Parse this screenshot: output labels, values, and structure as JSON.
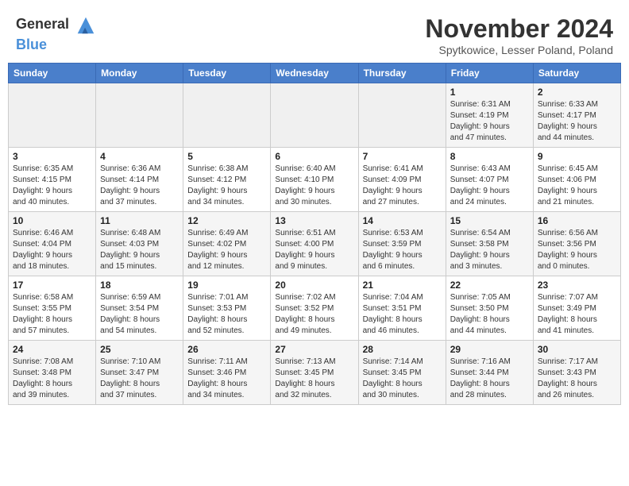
{
  "header": {
    "logo_general": "General",
    "logo_blue": "Blue",
    "month_title": "November 2024",
    "location": "Spytkowice, Lesser Poland, Poland"
  },
  "days_of_week": [
    "Sunday",
    "Monday",
    "Tuesday",
    "Wednesday",
    "Thursday",
    "Friday",
    "Saturday"
  ],
  "weeks": [
    [
      {
        "day": "",
        "info": ""
      },
      {
        "day": "",
        "info": ""
      },
      {
        "day": "",
        "info": ""
      },
      {
        "day": "",
        "info": ""
      },
      {
        "day": "",
        "info": ""
      },
      {
        "day": "1",
        "info": "Sunrise: 6:31 AM\nSunset: 4:19 PM\nDaylight: 9 hours\nand 47 minutes."
      },
      {
        "day": "2",
        "info": "Sunrise: 6:33 AM\nSunset: 4:17 PM\nDaylight: 9 hours\nand 44 minutes."
      }
    ],
    [
      {
        "day": "3",
        "info": "Sunrise: 6:35 AM\nSunset: 4:15 PM\nDaylight: 9 hours\nand 40 minutes."
      },
      {
        "day": "4",
        "info": "Sunrise: 6:36 AM\nSunset: 4:14 PM\nDaylight: 9 hours\nand 37 minutes."
      },
      {
        "day": "5",
        "info": "Sunrise: 6:38 AM\nSunset: 4:12 PM\nDaylight: 9 hours\nand 34 minutes."
      },
      {
        "day": "6",
        "info": "Sunrise: 6:40 AM\nSunset: 4:10 PM\nDaylight: 9 hours\nand 30 minutes."
      },
      {
        "day": "7",
        "info": "Sunrise: 6:41 AM\nSunset: 4:09 PM\nDaylight: 9 hours\nand 27 minutes."
      },
      {
        "day": "8",
        "info": "Sunrise: 6:43 AM\nSunset: 4:07 PM\nDaylight: 9 hours\nand 24 minutes."
      },
      {
        "day": "9",
        "info": "Sunrise: 6:45 AM\nSunset: 4:06 PM\nDaylight: 9 hours\nand 21 minutes."
      }
    ],
    [
      {
        "day": "10",
        "info": "Sunrise: 6:46 AM\nSunset: 4:04 PM\nDaylight: 9 hours\nand 18 minutes."
      },
      {
        "day": "11",
        "info": "Sunrise: 6:48 AM\nSunset: 4:03 PM\nDaylight: 9 hours\nand 15 minutes."
      },
      {
        "day": "12",
        "info": "Sunrise: 6:49 AM\nSunset: 4:02 PM\nDaylight: 9 hours\nand 12 minutes."
      },
      {
        "day": "13",
        "info": "Sunrise: 6:51 AM\nSunset: 4:00 PM\nDaylight: 9 hours\nand 9 minutes."
      },
      {
        "day": "14",
        "info": "Sunrise: 6:53 AM\nSunset: 3:59 PM\nDaylight: 9 hours\nand 6 minutes."
      },
      {
        "day": "15",
        "info": "Sunrise: 6:54 AM\nSunset: 3:58 PM\nDaylight: 9 hours\nand 3 minutes."
      },
      {
        "day": "16",
        "info": "Sunrise: 6:56 AM\nSunset: 3:56 PM\nDaylight: 9 hours\nand 0 minutes."
      }
    ],
    [
      {
        "day": "17",
        "info": "Sunrise: 6:58 AM\nSunset: 3:55 PM\nDaylight: 8 hours\nand 57 minutes."
      },
      {
        "day": "18",
        "info": "Sunrise: 6:59 AM\nSunset: 3:54 PM\nDaylight: 8 hours\nand 54 minutes."
      },
      {
        "day": "19",
        "info": "Sunrise: 7:01 AM\nSunset: 3:53 PM\nDaylight: 8 hours\nand 52 minutes."
      },
      {
        "day": "20",
        "info": "Sunrise: 7:02 AM\nSunset: 3:52 PM\nDaylight: 8 hours\nand 49 minutes."
      },
      {
        "day": "21",
        "info": "Sunrise: 7:04 AM\nSunset: 3:51 PM\nDaylight: 8 hours\nand 46 minutes."
      },
      {
        "day": "22",
        "info": "Sunrise: 7:05 AM\nSunset: 3:50 PM\nDaylight: 8 hours\nand 44 minutes."
      },
      {
        "day": "23",
        "info": "Sunrise: 7:07 AM\nSunset: 3:49 PM\nDaylight: 8 hours\nand 41 minutes."
      }
    ],
    [
      {
        "day": "24",
        "info": "Sunrise: 7:08 AM\nSunset: 3:48 PM\nDaylight: 8 hours\nand 39 minutes."
      },
      {
        "day": "25",
        "info": "Sunrise: 7:10 AM\nSunset: 3:47 PM\nDaylight: 8 hours\nand 37 minutes."
      },
      {
        "day": "26",
        "info": "Sunrise: 7:11 AM\nSunset: 3:46 PM\nDaylight: 8 hours\nand 34 minutes."
      },
      {
        "day": "27",
        "info": "Sunrise: 7:13 AM\nSunset: 3:45 PM\nDaylight: 8 hours\nand 32 minutes."
      },
      {
        "day": "28",
        "info": "Sunrise: 7:14 AM\nSunset: 3:45 PM\nDaylight: 8 hours\nand 30 minutes."
      },
      {
        "day": "29",
        "info": "Sunrise: 7:16 AM\nSunset: 3:44 PM\nDaylight: 8 hours\nand 28 minutes."
      },
      {
        "day": "30",
        "info": "Sunrise: 7:17 AM\nSunset: 3:43 PM\nDaylight: 8 hours\nand 26 minutes."
      }
    ]
  ]
}
